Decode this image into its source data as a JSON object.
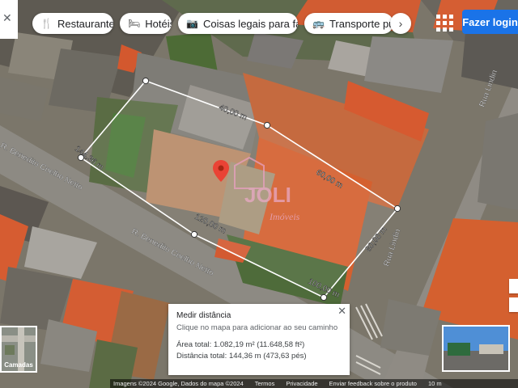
{
  "top_bar": {
    "chips": [
      {
        "label": "Restaurantes",
        "icon": "fork-knife-icon"
      },
      {
        "label": "Hotéis",
        "icon": "bed-icon"
      },
      {
        "label": "Coisas legais para fa...",
        "icon": "camera-icon"
      },
      {
        "label": "Transporte públ...",
        "icon": "bus-icon"
      }
    ],
    "login_label": "Fazer login"
  },
  "map": {
    "street_labels": [
      {
        "text": "R. Benedito Coelho Netto"
      },
      {
        "text": "R. Benedito Coelho Netto"
      },
      {
        "text": "Rua Lindin"
      },
      {
        "text": "Rua Lindin"
      }
    ],
    "distance_labels": [
      "40,00 m",
      "144,36 m",
      "60,00 m",
      "120,00 m",
      "80,00 m",
      "100,00 m"
    ],
    "watermark": {
      "brand": "JOLI",
      "sub": "Imóveis"
    }
  },
  "measure_panel": {
    "title": "Medir distância",
    "hint": "Clique no mapa para adicionar ao seu caminho",
    "area": "Área total: 1.082,19 m² (11.648,58 ft²)",
    "distance": "Distância total: 144,36 m (473,63 pés)"
  },
  "layers": {
    "label": "Camadas"
  },
  "footer": {
    "items": [
      "Imagens ©2024 Google, Dados do mapa ©2024",
      "Termos",
      "Privacidade",
      "Enviar feedback sobre o produto",
      "10 m"
    ]
  }
}
